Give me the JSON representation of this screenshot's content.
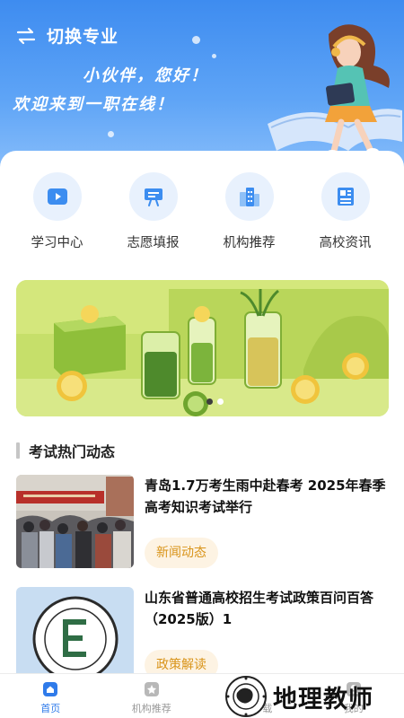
{
  "header": {
    "switch_label": "切换专业",
    "greeting_line1": "小伙伴，您好！",
    "greeting_line2": "欢迎来到一职在线！"
  },
  "quick_menu": [
    {
      "label": "学习中心",
      "icon": "play-icon"
    },
    {
      "label": "志愿填报",
      "icon": "presentation-icon"
    },
    {
      "label": "机构推荐",
      "icon": "building-icon"
    },
    {
      "label": "高校资讯",
      "icon": "newspaper-icon"
    }
  ],
  "banner": {
    "total_slides": 2,
    "active_slide": 1
  },
  "section": {
    "title": "考试热门动态"
  },
  "news": [
    {
      "title": "青岛1.7万考生雨中赴春考 2025年春季高考知识考试举行",
      "tag": "新闻动态"
    },
    {
      "title": "山东省普通高校招生考试政策百问百答 （2025版）1",
      "tag": "政策解读"
    }
  ],
  "bottom_nav": [
    {
      "label": "首页",
      "icon": "home-icon",
      "active": true
    },
    {
      "label": "机构推荐",
      "icon": "badge-icon",
      "active": false
    },
    {
      "label": "资料下载",
      "icon": "download-icon",
      "active": false
    },
    {
      "label": "我的",
      "icon": "user-icon",
      "active": false
    }
  ],
  "watermark": {
    "text": "地理教师"
  },
  "colors": {
    "header_blue": "#3e8cf0",
    "accent_blue": "#2f7bea",
    "tag_orange": "#d9941a"
  }
}
